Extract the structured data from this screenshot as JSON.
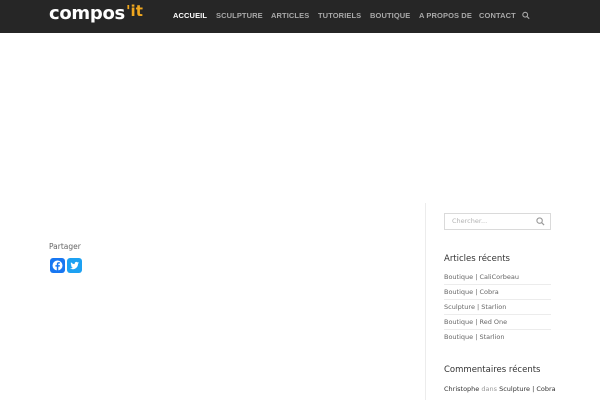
{
  "header": {
    "logo_text": "compos",
    "logo_accent": "'it",
    "nav": [
      {
        "label": "ACCUEIL",
        "active": true
      },
      {
        "label": "SCULPTURE",
        "active": false
      },
      {
        "label": "ARTICLES",
        "active": false
      },
      {
        "label": "TUTORIELS",
        "active": false
      },
      {
        "label": "BOUTIQUE",
        "active": false
      },
      {
        "label": "A PROPOS DE",
        "active": false
      },
      {
        "label": "CONTACT",
        "active": false
      }
    ],
    "search_icon": "search-icon"
  },
  "share": {
    "label": "Partager",
    "facebook_icon": "facebook-icon",
    "twitter_icon": "twitter-icon"
  },
  "sidebar": {
    "search_placeholder": "Chercher...",
    "recent_posts_title": "Articles récents",
    "recent_posts": [
      "Boutique | CaliCorbeau",
      "Boutique | Cobra",
      "Sculpture | Starlion",
      "Boutique | Red One",
      "Boutique | Starlion"
    ],
    "recent_comments_title": "Commentaires récents",
    "recent_comment": {
      "author": "Christophe",
      "connector": "dans",
      "post": "Sculpture | Cobra"
    }
  },
  "colors": {
    "header_bg": "#262626",
    "logo_accent": "#f0a71e",
    "facebook": "#1877f2",
    "twitter": "#1da1f2"
  }
}
